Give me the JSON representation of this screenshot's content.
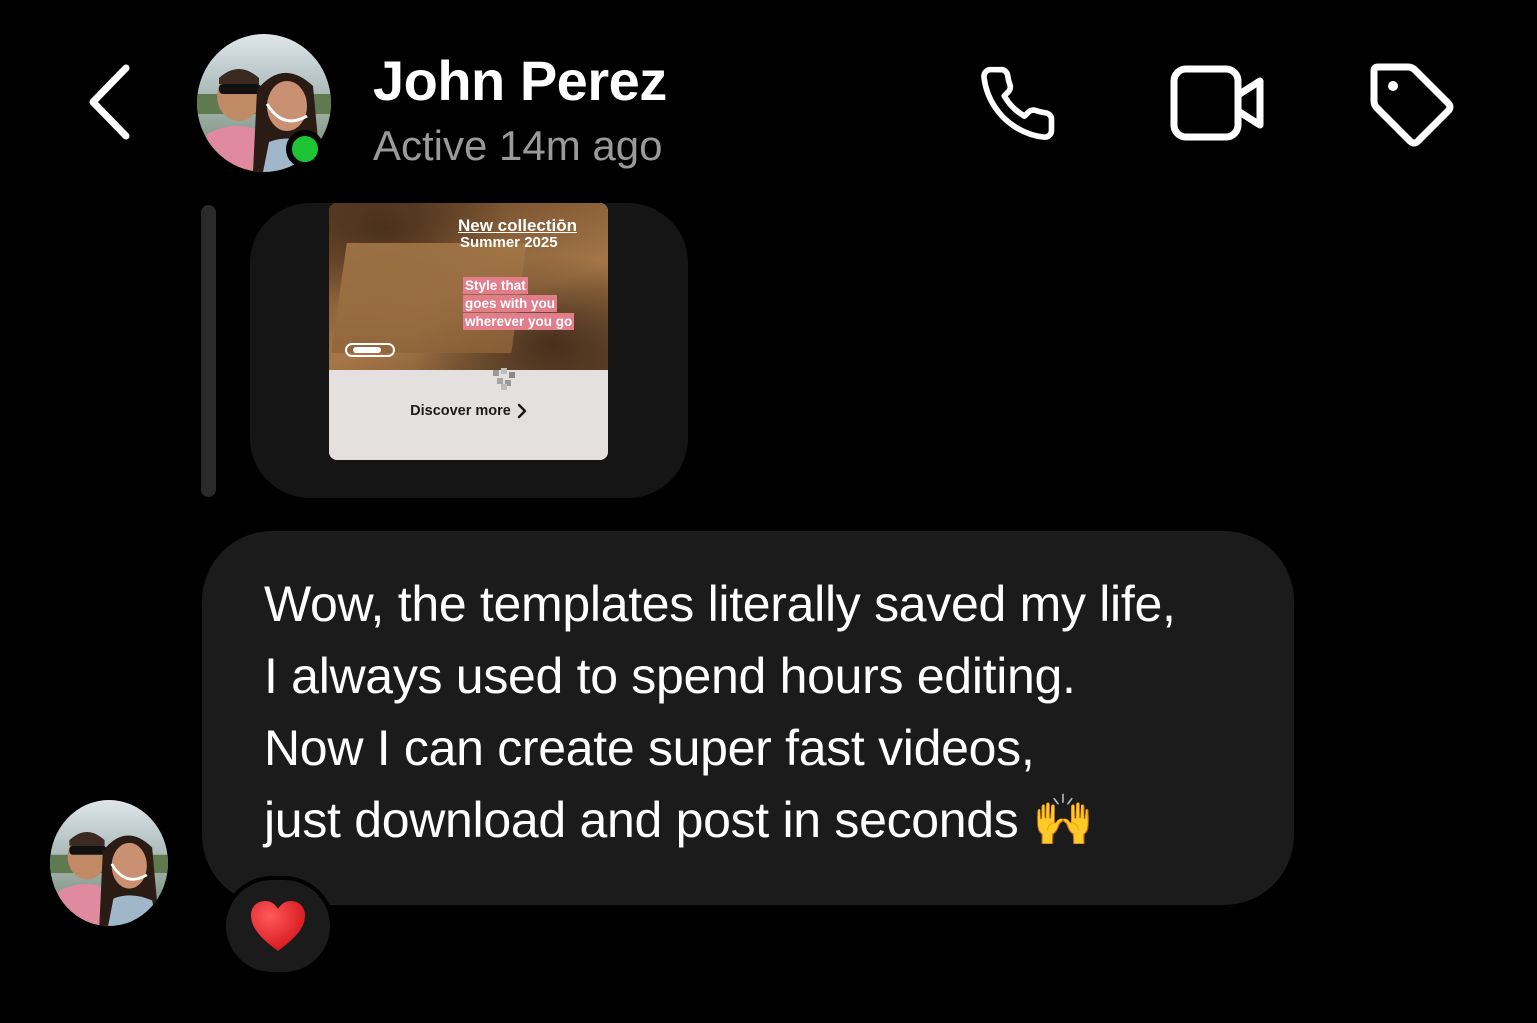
{
  "header": {
    "back_icon": "chevron-left-icon",
    "contact_name": "John Perez",
    "status": "Active 14m ago",
    "online_color": "#1dc534",
    "actions": [
      {
        "icon": "phone-icon",
        "label": "call"
      },
      {
        "icon": "video-camera-icon",
        "label": "video call"
      },
      {
        "icon": "tag-icon",
        "label": "tag"
      }
    ]
  },
  "shared_story": {
    "title": "New collectiōn",
    "subtitle": "Summer 2025",
    "tagline": [
      "Style that",
      "goes with you",
      "wherever you go"
    ],
    "tagline_color": "#e27e8c",
    "cta": "Discover more"
  },
  "message": {
    "text": "Wow, the templates literally saved my life,\nI always used to spend hours editing.\nNow I can create super fast videos,\njust download and post in seconds 🙌",
    "reaction": "❤️"
  }
}
